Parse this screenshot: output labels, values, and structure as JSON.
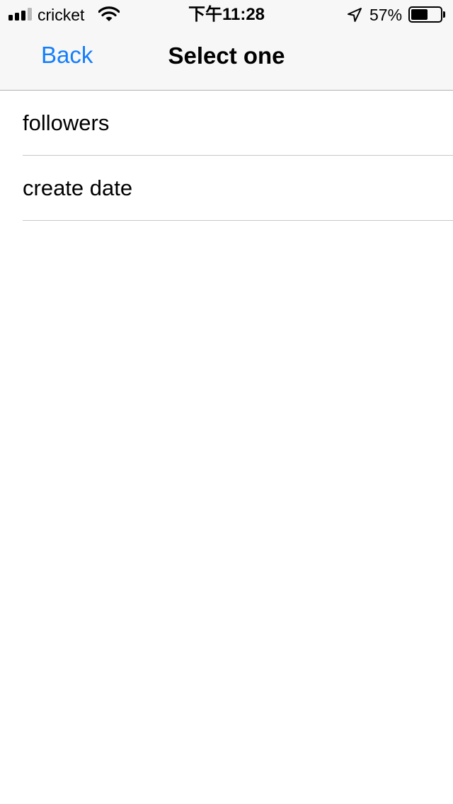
{
  "status_bar": {
    "carrier": "cricket",
    "time": "下午11:28",
    "battery_percent": "57%",
    "battery_level": 0.57
  },
  "nav": {
    "back_label": "Back",
    "title": "Select one"
  },
  "list": {
    "items": [
      {
        "label": "followers"
      },
      {
        "label": "create date"
      }
    ]
  },
  "colors": {
    "accent": "#147efb",
    "nav_background": "#f7f7f7",
    "separator": "#c8c7cc"
  },
  "icons": [
    "signal-icon",
    "wifi-icon",
    "location-arrow-icon",
    "battery-icon"
  ]
}
